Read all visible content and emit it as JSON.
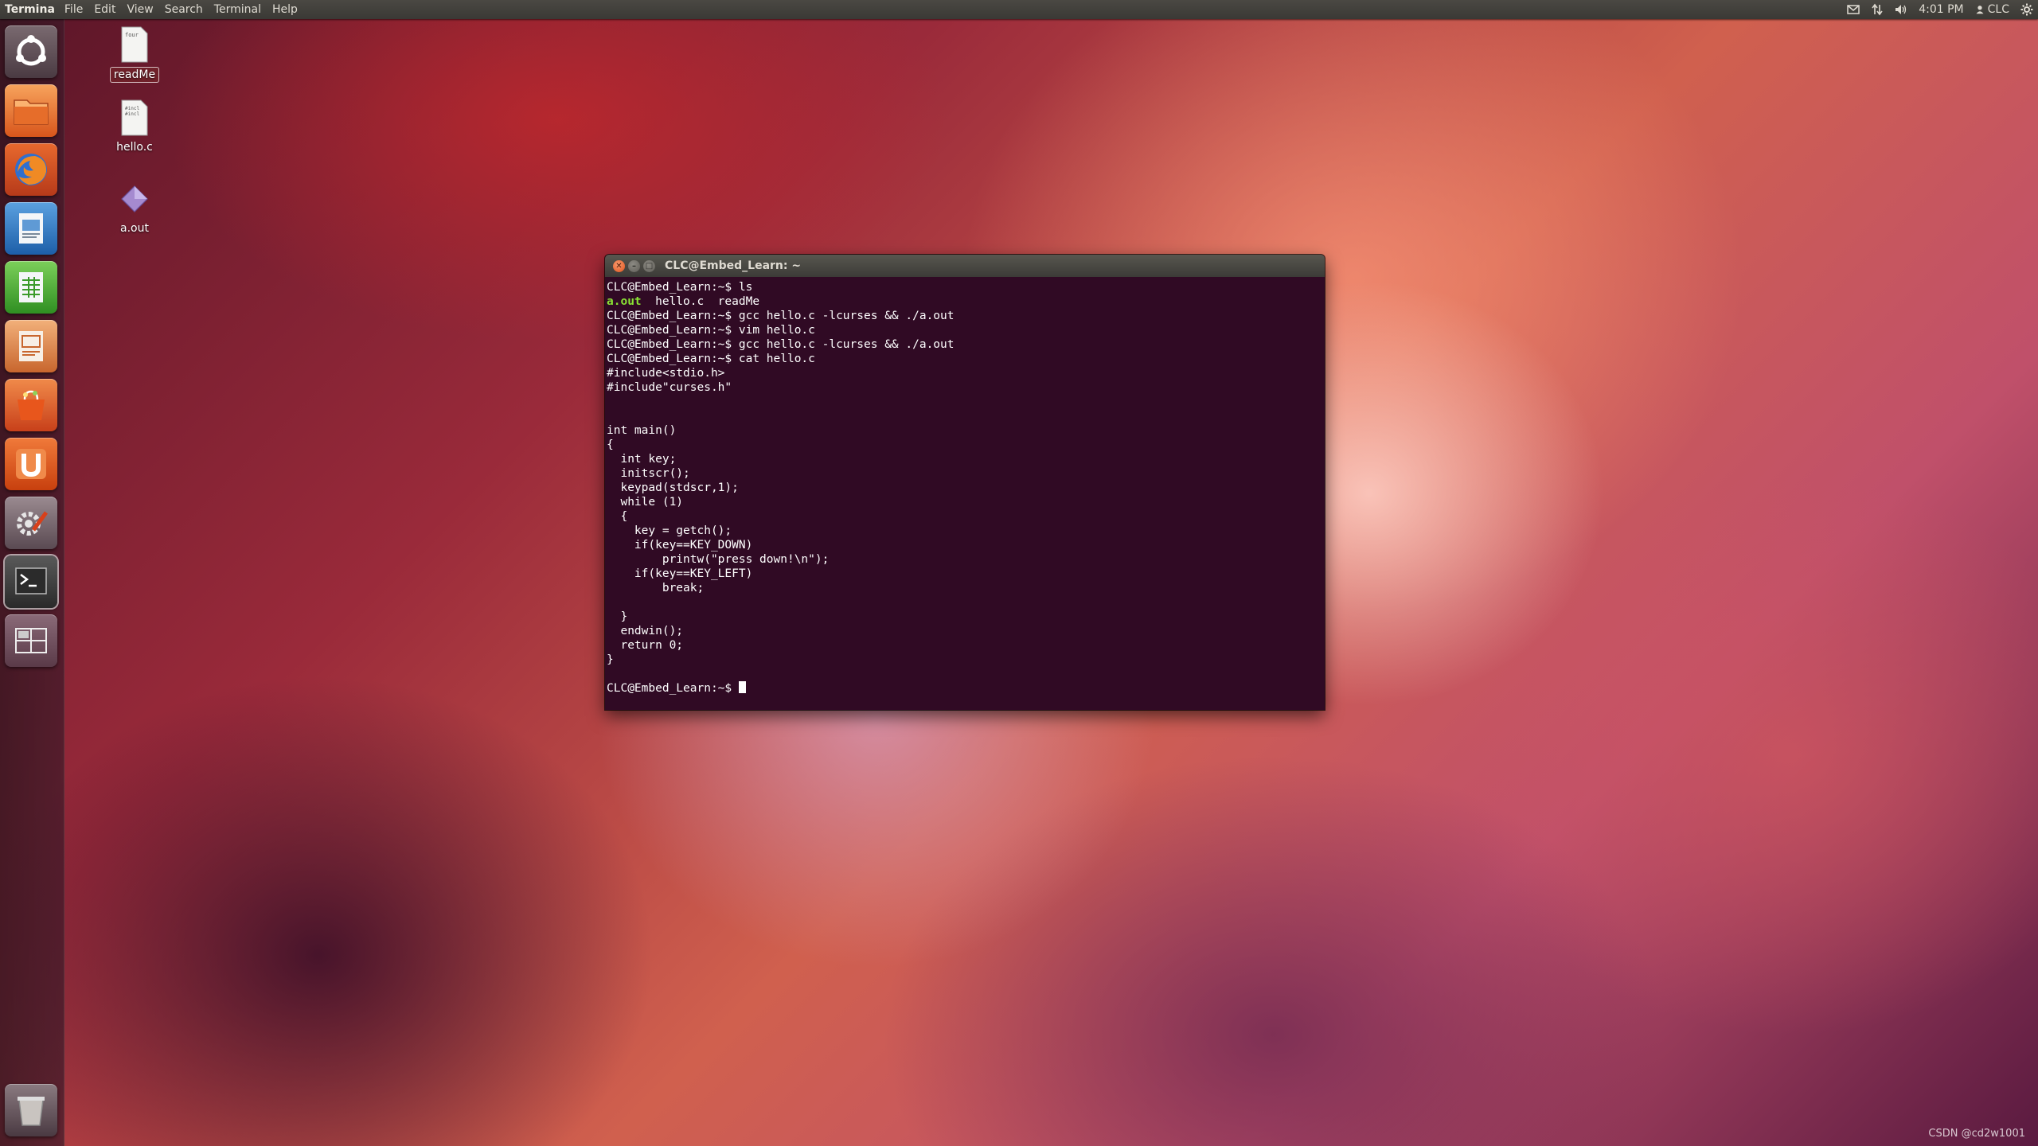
{
  "top_panel": {
    "app_name": "Termina",
    "menu": [
      "File",
      "Edit",
      "View",
      "Search",
      "Terminal",
      "Help"
    ],
    "tray": {
      "mail_icon": "mail-icon",
      "network_icon": "network-updown-icon",
      "volume_icon": "volume-icon",
      "clock": "4:01 PM",
      "user": "CLC",
      "settings_icon": "gear-icon"
    }
  },
  "launcher": {
    "items": [
      {
        "name": "dash-home-button",
        "icon": "ubuntu-logo-icon"
      },
      {
        "name": "files-button",
        "icon": "folder-icon"
      },
      {
        "name": "firefox-button",
        "icon": "firefox-icon"
      },
      {
        "name": "libreoffice-writer-button",
        "icon": "document-icon"
      },
      {
        "name": "libreoffice-calc-button",
        "icon": "spreadsheet-icon"
      },
      {
        "name": "libreoffice-impress-button",
        "icon": "presentation-icon"
      },
      {
        "name": "software-center-button",
        "icon": "shopping-bag-icon"
      },
      {
        "name": "ubuntu-one-button",
        "icon": "ubuntu-one-icon"
      },
      {
        "name": "system-settings-button",
        "icon": "wrench-gear-icon"
      },
      {
        "name": "terminal-button",
        "icon": "terminal-icon"
      },
      {
        "name": "workspace-switcher-button",
        "icon": "workspaces-icon"
      },
      {
        "name": "trash-button",
        "icon": "trash-icon"
      }
    ]
  },
  "desktop": {
    "icons": [
      {
        "label": "readMe",
        "selected": true
      },
      {
        "label": "hello.c",
        "selected": false
      },
      {
        "label": "a.out",
        "selected": false
      }
    ],
    "readme_preview": "four",
    "helloc_preview": [
      "#incl",
      "#incl"
    ]
  },
  "terminal": {
    "title": "CLC@Embed_Learn: ~",
    "lines": [
      "CLC@Embed_Learn:~$ ls",
      "__LS_OUTPUT__",
      "CLC@Embed_Learn:~$ gcc hello.c -lcurses && ./a.out",
      "CLC@Embed_Learn:~$ vim hello.c",
      "CLC@Embed_Learn:~$ gcc hello.c -lcurses && ./a.out",
      "CLC@Embed_Learn:~$ cat hello.c",
      "#include<stdio.h>",
      "#include\"curses.h\"",
      "",
      "",
      "int main()",
      "{",
      "  int key;",
      "  initscr();",
      "  keypad(stdscr,1);",
      "  while (1)",
      "  {",
      "    key = getch();",
      "    if(key==KEY_DOWN)",
      "        printw(\"press down!\\n\");",
      "    if(key==KEY_LEFT)",
      "        break;",
      "",
      "  }",
      "  endwin();",
      "  return 0;",
      "}",
      "",
      "__PROMPT__"
    ],
    "ls_output": {
      "exec": "a.out",
      "rest": "  hello.c  readMe"
    },
    "prompt": "CLC@Embed_Learn:~$ "
  },
  "watermark": "CSDN @cd2w1001"
}
